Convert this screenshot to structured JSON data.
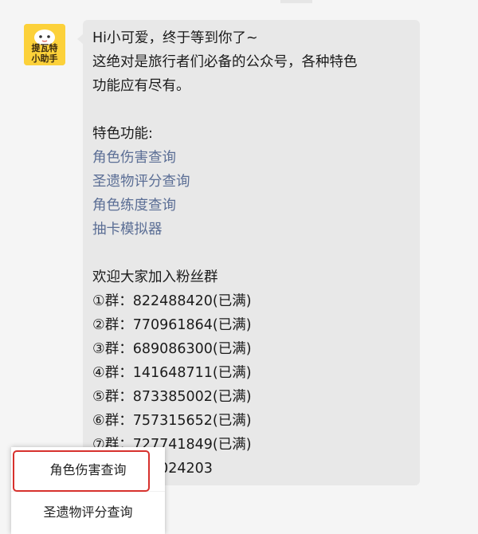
{
  "sender": {
    "avatar_text_line1": "提瓦特",
    "avatar_text_line2": "小助手"
  },
  "message": {
    "greeting": "Hi小可爱，终于等到你了~",
    "intro_line1": "这绝对是旅行者们必备的公众号，各种特色",
    "intro_line2": "功能应有尽有。",
    "features_title": "特色功能:",
    "features": [
      "角色伤害查询",
      "圣遗物评分查询",
      "角色练度查询",
      "抽卡模拟器"
    ],
    "groups_title": "欢迎大家加入粉丝群",
    "groups": [
      "①群：822488420(已满)",
      "②群：770961864(已满)",
      "③群：689086300(已满)",
      "④群：141648711(已满)",
      "⑤群：873385002(已满)",
      "⑥群：757315652(已满)",
      "⑦群：727741849(已满)",
      "⑧群：761024203"
    ]
  },
  "popup_menu": {
    "items": [
      "角色伤害查询",
      "圣遗物评分查询"
    ],
    "highlight_color": "#d7312d"
  }
}
